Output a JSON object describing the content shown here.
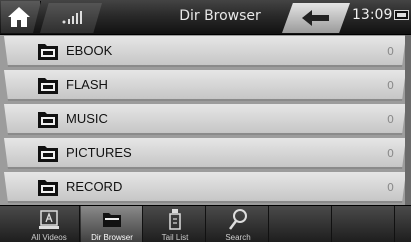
{
  "header": {
    "title": "Dir Browser",
    "time": "13:09",
    "icons": [
      "home-icon",
      "signal-icon",
      "back-arrow-icon",
      "battery-icon"
    ]
  },
  "list": {
    "items": [
      {
        "name": "EBOOK",
        "count": "0",
        "icon": "folder-icon"
      },
      {
        "name": "FLASH",
        "count": "0",
        "icon": "folder-icon"
      },
      {
        "name": "MUSIC",
        "count": "0",
        "icon": "folder-icon"
      },
      {
        "name": "PICTURES",
        "count": "0",
        "icon": "folder-icon"
      },
      {
        "name": "RECORD",
        "count": "0",
        "icon": "folder-icon"
      }
    ]
  },
  "tabs": [
    {
      "label": "All Videos",
      "icon": "video-icon",
      "active": false
    },
    {
      "label": "Dir Browser",
      "icon": "folder-icon",
      "active": true
    },
    {
      "label": "Tail List",
      "icon": "bottle-icon",
      "active": false
    },
    {
      "label": "Search",
      "icon": "search-icon",
      "active": false
    }
  ]
}
